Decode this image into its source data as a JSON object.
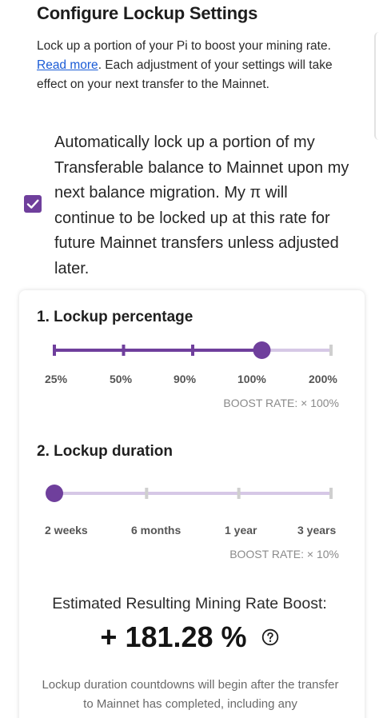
{
  "header": {
    "title": "Configure Lockup Settings"
  },
  "intro": {
    "text_before": "Lock up a portion of your Pi to boost your mining rate. ",
    "read_more": "Read more",
    "text_after": ". Each adjustment of your settings will take effect on your next transfer to the Mainnet."
  },
  "auto_lockup": {
    "checked": true,
    "text": "Automatically lock up a portion of my Transferable balance to Mainnet upon my next balance migration. My π will continue to be locked up at this rate for future Mainnet transfers unless adjusted later."
  },
  "lockup_percentage": {
    "title": "1. Lockup percentage",
    "options": [
      "25%",
      "50%",
      "90%",
      "100%",
      "200%"
    ],
    "selected_index": 3,
    "boost_rate": "BOOST RATE: × 100%"
  },
  "lockup_duration": {
    "title": "2. Lockup duration",
    "options": [
      "2 weeks",
      "6 months",
      "1 year",
      "3 years"
    ],
    "selected_index": 0,
    "boost_rate": "BOOST RATE: × 10%"
  },
  "estimate": {
    "label": "Estimated Resulting Mining Rate Boost:",
    "value": "+ 181.28 %"
  },
  "footnote": "Lockup duration countdowns will begin after the transfer to Mainnet has completed, including any",
  "colors": {
    "accent": "#6f3f9c",
    "track_inactive": "#d6c8e6",
    "tick_inactive": "#cfcfcf"
  }
}
